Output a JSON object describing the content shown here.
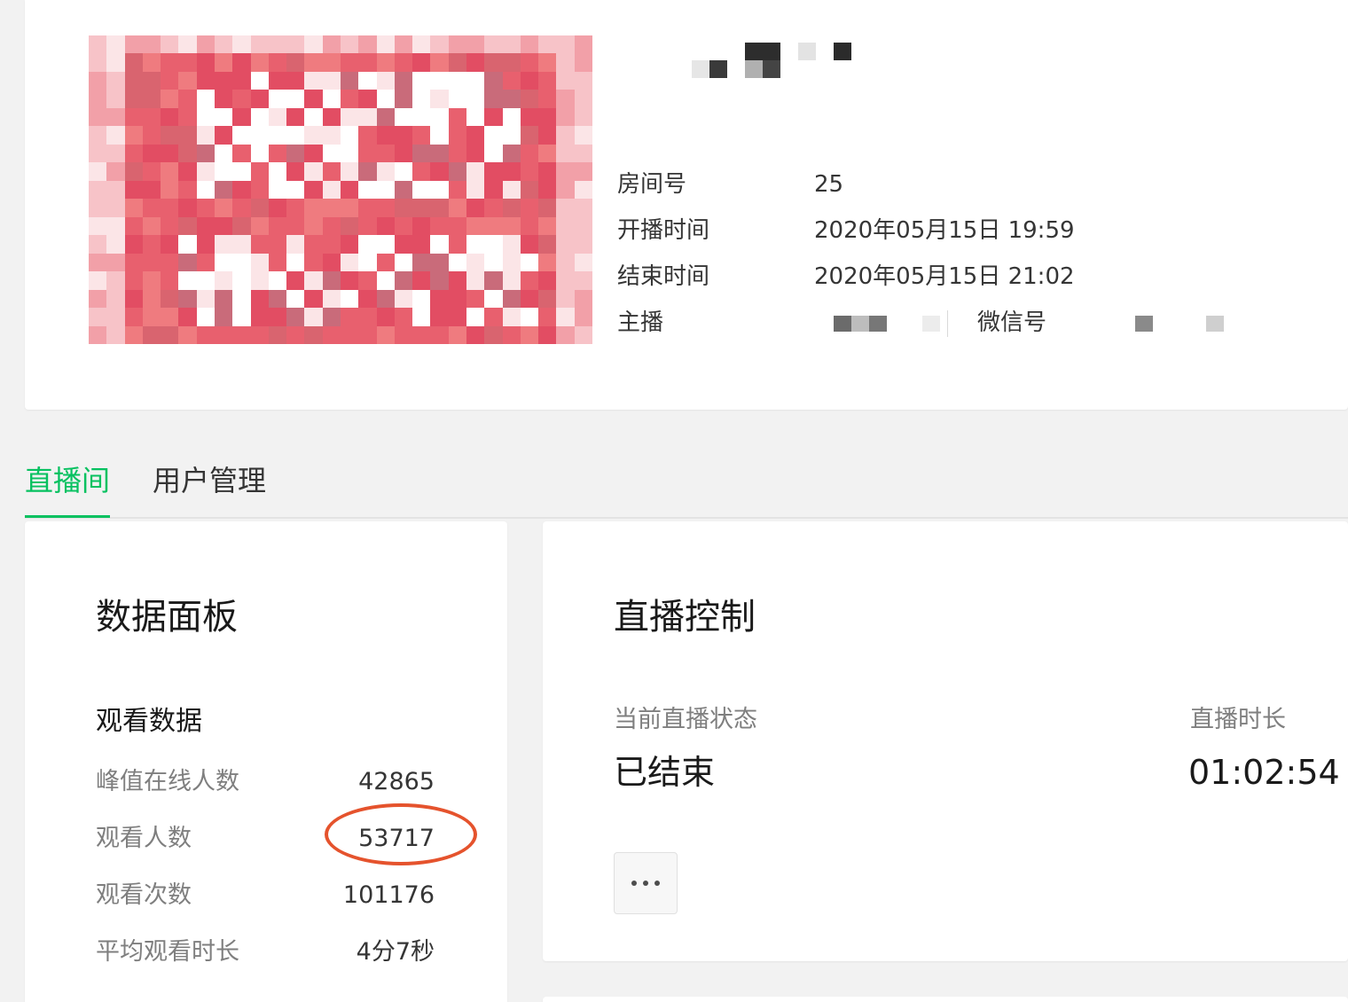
{
  "room": {
    "info": [
      {
        "label": "房间号",
        "value": "25"
      },
      {
        "label": "开播时间",
        "value": "2020年05月15日 19:59"
      },
      {
        "label": "结束时间",
        "value": "2020年05月15日 21:02"
      }
    ],
    "anchor_label": "主播",
    "wechat_label": "微信号"
  },
  "tabs": [
    {
      "label": "直播间",
      "active": true
    },
    {
      "label": "用户管理",
      "active": false
    }
  ],
  "data_panel": {
    "title": "数据面板",
    "section_title": "观看数据",
    "stats": [
      {
        "label": "峰值在线人数",
        "value": "42865"
      },
      {
        "label": "观看人数",
        "value": "53717"
      },
      {
        "label": "观看次数",
        "value": "101176"
      },
      {
        "label": "平均观看时长",
        "value": "4分7秒"
      }
    ]
  },
  "live_panel": {
    "title": "直播控制",
    "status_label": "当前直播状态",
    "status_value": "已结束",
    "duration_label": "直播时长",
    "duration_value": "01:02:54",
    "more_icon": "ellipsis-icon"
  },
  "colors": {
    "accent": "#07c160",
    "annotation": "#e5532d"
  }
}
